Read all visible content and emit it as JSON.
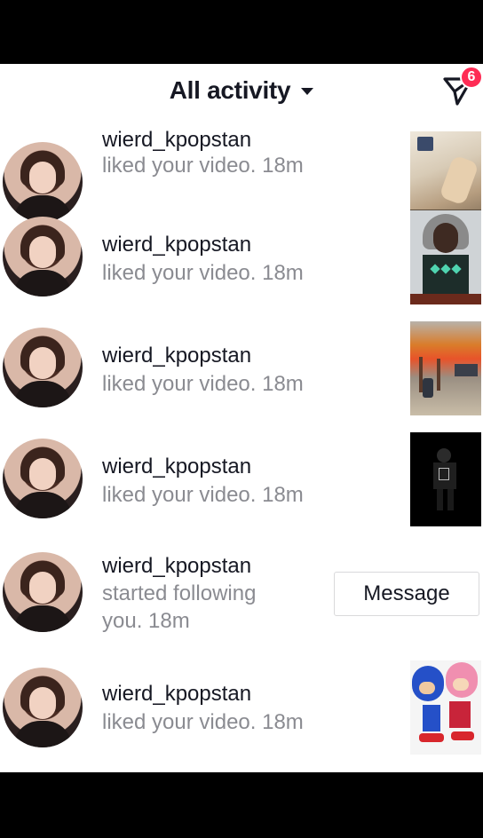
{
  "header": {
    "title": "All activity",
    "inbox_badge": "6"
  },
  "activities": [
    {
      "username": "wierd_kpopstan",
      "action": "liked your video.",
      "time": "18m",
      "thumb_icon": "video-thumbnail"
    },
    {
      "username": "wierd_kpopstan",
      "action": "liked your video.",
      "time": "18m",
      "thumb_icon": "video-thumbnail"
    },
    {
      "username": "wierd_kpopstan",
      "action": "liked your video.",
      "time": "18m",
      "thumb_icon": "video-thumbnail"
    },
    {
      "username": "wierd_kpopstan",
      "action": "liked your video.",
      "time": "18m",
      "thumb_icon": "video-thumbnail"
    },
    {
      "username": "wierd_kpopstan",
      "action_line1": "started following",
      "action_line2": "you.",
      "time": "18m",
      "button_label": "Message"
    },
    {
      "username": "wierd_kpopstan",
      "action": "liked your video.",
      "time": "18m",
      "thumb_icon": "video-thumbnail"
    }
  ],
  "colors": {
    "accent": "#fe2c55",
    "text_primary": "#161823",
    "text_secondary": "#8a8b91"
  }
}
